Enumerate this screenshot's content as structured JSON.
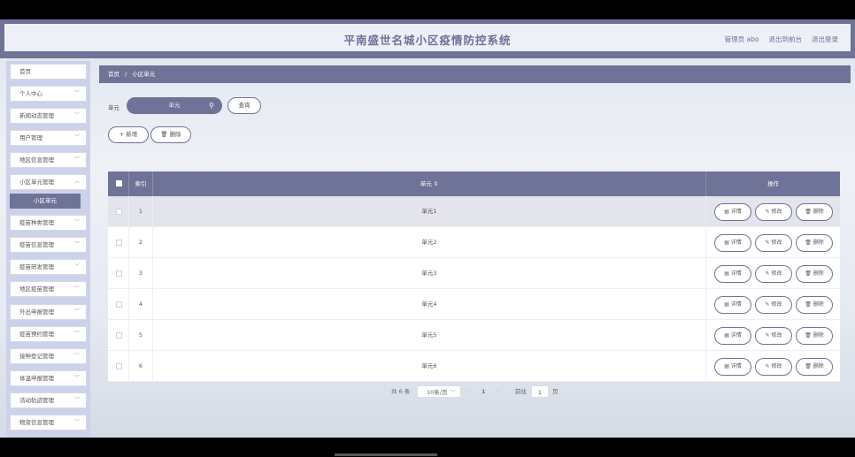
{
  "header": {
    "title": "平南盛世名城小区疫情防控系统",
    "links": [
      "管理员 abo",
      "退出到前台",
      "退出登录"
    ]
  },
  "sidebar": {
    "items": [
      "首页",
      "个人中心",
      "新闻动态管理",
      "用户管理",
      "地区信息管理",
      "小区单元管理",
      "疫苗种类管理",
      "疫苗信息管理",
      "疫苗研发管理",
      "地区疫苗管理",
      "外出申报管理",
      "疫苗预约管理",
      "接种登记管理",
      "体温申报管理",
      "活动轨迹管理",
      "物资信息管理"
    ],
    "active_sub": "小区单元"
  },
  "breadcrumb": {
    "home": "首页",
    "sep": "/",
    "current": "小区单元"
  },
  "search": {
    "label": "单元",
    "placeholder": "单元",
    "button": "查询"
  },
  "actions": {
    "add": "+ 新增",
    "delete": "删除"
  },
  "table": {
    "headers": {
      "index": "索引",
      "unit": "单元 ⇕",
      "ops": "操作"
    },
    "rows": [
      {
        "index": "1",
        "unit": "单元1"
      },
      {
        "index": "2",
        "unit": "单元2"
      },
      {
        "index": "3",
        "unit": "单元3"
      },
      {
        "index": "4",
        "unit": "单元4"
      },
      {
        "index": "5",
        "unit": "单元5"
      },
      {
        "index": "6",
        "unit": "单元6"
      }
    ],
    "op_labels": {
      "detail": "详情",
      "edit": "修改",
      "delete": "删除"
    }
  },
  "pagination": {
    "total": "共 6 条",
    "page_size": "10条/页",
    "current_page": "1",
    "goto_label": "前往",
    "goto_value": "1",
    "page_suffix": "页"
  }
}
